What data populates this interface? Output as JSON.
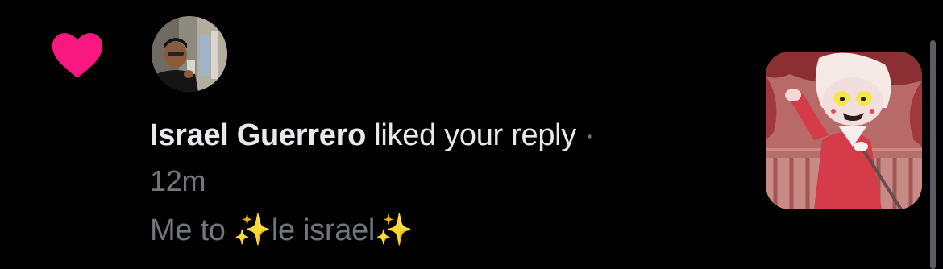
{
  "notification": {
    "user_name": "Israel Guerrero",
    "action": "liked your reply",
    "separator": "·",
    "timestamp": "12m",
    "reply_text": "Me to ✨le israel✨"
  },
  "icons": {
    "activity": "heart-icon",
    "avatar": "user-avatar",
    "post_thumbnail": "post-thumbnail"
  },
  "colors": {
    "heart": "#f91880",
    "background": "#000000",
    "primary_text": "#e7e9ea",
    "secondary_text": "#71767b"
  }
}
